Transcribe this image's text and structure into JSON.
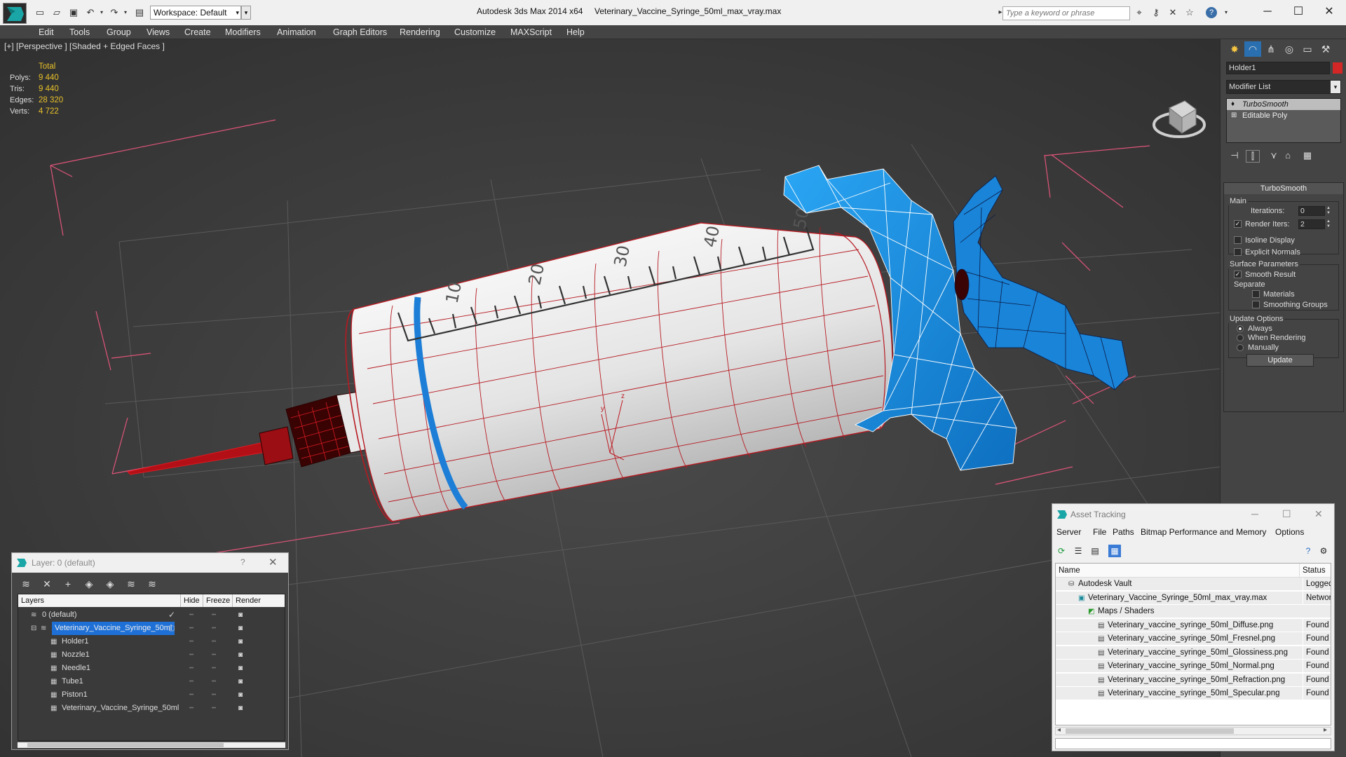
{
  "titlebar": {
    "app_title": "Autodesk 3ds Max  2014 x64",
    "file_title": "Veterinary_Vaccine_Syringe_50ml_max_vray.max",
    "workspace": "Workspace: Default",
    "search_placeholder": "Type a keyword or phrase",
    "icons": [
      "new-file-icon",
      "open-folder-icon",
      "save-icon",
      "undo-icon",
      "redo-icon",
      "project-folder-icon"
    ],
    "help": "?"
  },
  "menu": [
    "Edit",
    "Tools",
    "Group",
    "Views",
    "Create",
    "Modifiers",
    "Animation",
    "Graph Editors",
    "Rendering",
    "Customize",
    "MAXScript",
    "Help"
  ],
  "viewport": {
    "label": "[+] [Perspective ] [Shaded + Edged Faces ]",
    "stats": {
      "header": "Total",
      "rows": [
        {
          "label": "Polys:",
          "value": "9 440"
        },
        {
          "label": "Tris:",
          "value": "9 440"
        },
        {
          "label": "Edges:",
          "value": "28 320"
        },
        {
          "label": "Verts:",
          "value": "4 722"
        }
      ]
    },
    "scale_marks": [
      "10",
      "20",
      "30",
      "40",
      "50"
    ],
    "axis_labels": [
      "y",
      "z"
    ],
    "colors": {
      "barrel": "#e6e6e6",
      "holder": "#1b8be0",
      "wire": "#c01820",
      "grid": "#e0557a"
    }
  },
  "command_panel": {
    "object_name": "Holder1",
    "object_color": "#d32626",
    "modifier_list": "Modifier List",
    "stack": [
      "TurboSmooth",
      "Editable Poly"
    ],
    "rollout_title": "TurboSmooth",
    "main": {
      "title": "Main",
      "iterations_label": "Iterations:",
      "iterations": "0",
      "render_iters_label": "Render Iters:",
      "render_iters": "2",
      "render_iters_checked": true
    },
    "isoline": {
      "label": "Isoline Display",
      "checked": false
    },
    "explicit_normals": {
      "label": "Explicit Normals",
      "checked": false
    },
    "surface": {
      "title": "Surface Parameters",
      "smooth_result": {
        "label": "Smooth Result",
        "checked": true
      },
      "separate": "Separate",
      "materials": {
        "label": "Materials",
        "checked": false
      },
      "smoothing_groups": {
        "label": "Smoothing Groups",
        "checked": false
      }
    },
    "update_options": {
      "title": "Update Options",
      "options": [
        "Always",
        "When Rendering",
        "Manually"
      ],
      "selected": "Always"
    },
    "update_button": "Update"
  },
  "layer_window": {
    "title": "Layer: 0 (default)",
    "help": "?",
    "columns": [
      "Layers",
      "Hide",
      "Freeze",
      "Render"
    ],
    "rows": [
      {
        "name": "0 (default)",
        "indent": 0,
        "selected": false,
        "checkmark": "✓"
      },
      {
        "name": "Veterinary_Vaccine_Syringe_50ml",
        "indent": 1,
        "selected": true,
        "checkmark": ""
      },
      {
        "name": "Holder1",
        "indent": 2,
        "selected": false,
        "checkmark": ""
      },
      {
        "name": "Nozzle1",
        "indent": 2,
        "selected": false,
        "checkmark": ""
      },
      {
        "name": "Needle1",
        "indent": 2,
        "selected": false,
        "checkmark": ""
      },
      {
        "name": "Tube1",
        "indent": 2,
        "selected": false,
        "checkmark": ""
      },
      {
        "name": "Piston1",
        "indent": 2,
        "selected": false,
        "checkmark": ""
      },
      {
        "name": "Veterinary_Vaccine_Syringe_50ml",
        "indent": 2,
        "selected": false,
        "checkmark": ""
      }
    ]
  },
  "asset_window": {
    "title": "Asset Tracking",
    "menu": [
      "Server",
      "File",
      "Paths",
      "Bitmap Performance and Memory",
      "Options"
    ],
    "columns": [
      "Name",
      "Status"
    ],
    "rows": [
      {
        "name": "Autodesk Vault",
        "status": "Logged",
        "indent": 1
      },
      {
        "name": "Veterinary_Vaccine_Syringe_50ml_max_vray.max",
        "status": "Network",
        "indent": 2
      },
      {
        "name": "Maps / Shaders",
        "status": "",
        "indent": 3
      },
      {
        "name": "Veterinary_vaccine_syringe_50ml_Diffuse.png",
        "status": "Found",
        "indent": 4
      },
      {
        "name": "Veterinary_vaccine_syringe_50ml_Fresnel.png",
        "status": "Found",
        "indent": 4
      },
      {
        "name": "Veterinary_vaccine_syringe_50ml_Glossiness.png",
        "status": "Found",
        "indent": 4
      },
      {
        "name": "Veterinary_vaccine_syringe_50ml_Normal.png",
        "status": "Found",
        "indent": 4
      },
      {
        "name": "Veterinary_vaccine_syringe_50ml_Refraction.png",
        "status": "Found",
        "indent": 4
      },
      {
        "name": "Veterinary_vaccine_syringe_50ml_Specular.png",
        "status": "Found",
        "indent": 4
      }
    ]
  }
}
